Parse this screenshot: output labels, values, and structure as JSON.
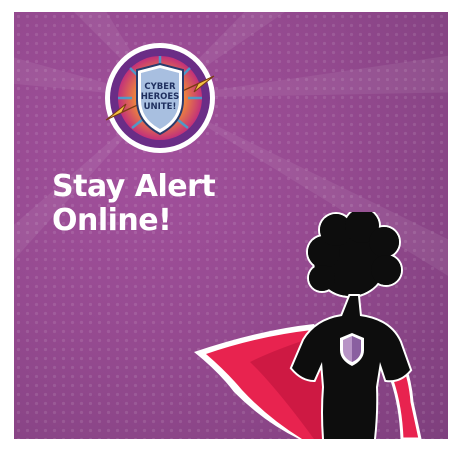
{
  "badge": {
    "text_lines": [
      "CYBER",
      "HEROES",
      "UNITE!"
    ]
  },
  "headline": {
    "line1": "Stay Alert",
    "line2": "Online!"
  },
  "colors": {
    "background": "#954a90",
    "cape": "#e8234f",
    "badge_ring": "#6a2d86",
    "shield": "#a8bfe0",
    "emblem": "#b894c6"
  }
}
